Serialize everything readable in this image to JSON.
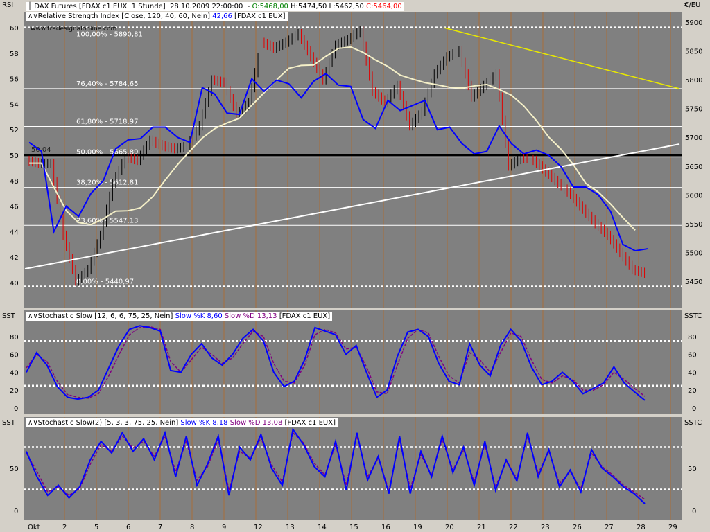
{
  "panels": [
    {
      "id": "rsi",
      "left_label": "RSI",
      "right_label": "€/EU",
      "header_lines": [
        [
          {
            "text": "DAX Futures [FDAX c1 EUX  1 Stunde]  28.10.2009 22:00:00  - ",
            "color": "#000000"
          },
          {
            "text": "O:5468,00",
            "color": "#008000"
          },
          {
            "text": " H:5474,50 L:5462,50 ",
            "color": "#000000"
          },
          {
            "text": "C:5464,00",
            "color": "#ff0000"
          }
        ],
        [
          {
            "text": "Relative Strength Index [Close, 120, 40, 60, Nein] ",
            "color": "#000000"
          },
          {
            "text": "42,66",
            "color": "#0000ff"
          },
          {
            "text": " [FDAX c1 EUX]",
            "color": "#000000"
          }
        ]
      ],
      "watermark": "www.tradesignalonline.com",
      "left_axis": {
        "ticks": [
          60,
          58,
          56,
          54,
          52,
          50,
          48,
          46,
          44,
          42,
          40
        ]
      },
      "right_axis": {
        "ticks": [
          "5900",
          "5850",
          "5800",
          "5750",
          "5700",
          "5650",
          "5600",
          "5550",
          "5500",
          "5450"
        ]
      },
      "fib_levels": [
        {
          "label": "100,00% - 5890,81",
          "price": 5890.81,
          "dotted": true
        },
        {
          "label": "76,40% - 5784,65",
          "price": 5784.65,
          "dotted": false
        },
        {
          "label": "61,80% - 5718,97",
          "price": 5718.97,
          "dotted": false
        },
        {
          "label": "50,00% - 5665,89",
          "price": 5665.89,
          "dotted": false
        },
        {
          "label": "38,20% - 5612,81",
          "price": 5612.81,
          "dotted": false
        },
        {
          "label": "23,60% - 5547,13",
          "price": 5547.13,
          "dotted": false
        },
        {
          "label": "0,00% - 5440,97",
          "price": 5440.97,
          "dotted": true
        }
      ],
      "rsi_midline": 50,
      "rsi_value_label": "50,04",
      "colors": {
        "rsi": "#0000ff",
        "ma": "#f5f0c8",
        "trend": "#ffffff",
        "resistance": "#e8e800",
        "up": "#000000",
        "down": "#e00000"
      }
    },
    {
      "id": "stoch1",
      "left_label": "SST",
      "right_label": "SSTC",
      "header_lines": [
        [
          {
            "text": "Stochastic Slow [12, 6, 6, 75, 25, Nein] ",
            "color": "#000000"
          },
          {
            "text": "Slow %K 8,60",
            "color": "#0000ff"
          },
          {
            "text": " ",
            "color": "#000000"
          },
          {
            "text": "Slow %D 13,13",
            "color": "#800080"
          },
          {
            "text": " [FDAX c1 EUX]",
            "color": "#000000"
          }
        ]
      ],
      "left_axis": {
        "ticks": [
          80,
          60,
          40,
          20,
          0
        ]
      },
      "right_axis": {
        "ticks": [
          "80",
          "60",
          "40",
          "20",
          "0"
        ]
      },
      "levels": [
        75,
        25
      ],
      "colors": {
        "k": "#0000ff",
        "d": "#800080"
      }
    },
    {
      "id": "stoch2",
      "left_label": "SST",
      "right_label": "SSTC",
      "header_lines": [
        [
          {
            "text": "Stochastic Slow(2) [5, 3, 3, 75, 25, Nein] ",
            "color": "#000000"
          },
          {
            "text": "Slow %K 8,18",
            "color": "#0000ff"
          },
          {
            "text": " ",
            "color": "#000000"
          },
          {
            "text": "Slow %D 13,08",
            "color": "#800080"
          },
          {
            "text": " [FDAX c1 EUX]",
            "color": "#000000"
          }
        ]
      ],
      "left_axis": {
        "ticks": [
          50,
          0
        ]
      },
      "right_axis": {
        "ticks": [
          "50",
          "0"
        ]
      },
      "levels": [
        75,
        25
      ],
      "colors": {
        "k": "#0000ff",
        "d": "#800080"
      }
    }
  ],
  "x_axis": {
    "labels": [
      "Okt",
      "2",
      "5",
      "6",
      "7",
      "8",
      "9",
      "12",
      "13",
      "14",
      "15",
      "16",
      "19",
      "20",
      "21",
      "22",
      "23",
      "26",
      "27",
      "28",
      "29"
    ]
  },
  "chart_data": [
    {
      "type": "line",
      "title": "DAX Futures [FDAX c1 EUX  1 Stunde]",
      "series": [
        {
          "name": "Relative Strength Index",
          "values": [
            51,
            50.3,
            44,
            46,
            45.2,
            47,
            48,
            50.5,
            51.2,
            51.3,
            52.2,
            52.2,
            51.4,
            51,
            55.3,
            54.8,
            53.3,
            53.2,
            56,
            55,
            55.9,
            55.6,
            54.5,
            55.8,
            56.4,
            55.5,
            55.4,
            52.8,
            52.1,
            54.3,
            53.5,
            53.9,
            54.3,
            52,
            52.2,
            50.9,
            50.1,
            50.3,
            52.3,
            50.9,
            50.1,
            50.4,
            50,
            49.1,
            47.5,
            47.5,
            46.9,
            45.6,
            43,
            42.5,
            42.66
          ]
        },
        {
          "name": "C",
          "values": [
            5655,
            5655,
            5530,
            5450,
            5470,
            5530,
            5620,
            5665,
            5660,
            5695,
            5685,
            5680,
            5685,
            5720,
            5800,
            5795,
            5740,
            5760,
            5865,
            5855,
            5865,
            5880,
            5840,
            5800,
            5860,
            5870,
            5885,
            5780,
            5760,
            5790,
            5720,
            5745,
            5810,
            5840,
            5850,
            5770,
            5790,
            5810,
            5650,
            5665,
            5660,
            5640,
            5620,
            5600,
            5575,
            5550,
            5530,
            5500,
            5470,
            5464
          ]
        }
      ]
    },
    {
      "type": "line",
      "title": "Stochastic Slow [12, 6, 6, 75, 25, Nein]",
      "ylim": [
        0,
        100
      ],
      "series": [
        {
          "name": "Slow %K",
          "values": [
            40,
            62,
            48,
            24,
            12,
            10,
            12,
            20,
            45,
            70,
            88,
            92,
            90,
            86,
            42,
            40,
            60,
            72,
            56,
            48,
            60,
            78,
            88,
            75,
            40,
            24,
            30,
            54,
            90,
            86,
            82,
            60,
            70,
            40,
            12,
            20,
            58,
            85,
            88,
            80,
            50,
            30,
            26,
            72,
            48,
            36,
            70,
            88,
            75,
            46,
            26,
            30,
            40,
            30,
            16,
            22,
            28,
            46,
            28,
            18,
            8.6
          ]
        },
        {
          "name": "Slow %D",
          "values": [
            45,
            60,
            52,
            30,
            15,
            12,
            11,
            16,
            36,
            60,
            82,
            90,
            91,
            88,
            52,
            40,
            54,
            68,
            60,
            50,
            56,
            72,
            86,
            80,
            50,
            30,
            28,
            48,
            82,
            88,
            84,
            66,
            68,
            46,
            18,
            16,
            48,
            78,
            88,
            84,
            58,
            36,
            28,
            62,
            54,
            40,
            62,
            84,
            80,
            54,
            32,
            28,
            36,
            32,
            20,
            20,
            26,
            40,
            32,
            22,
            13.13
          ]
        }
      ]
    },
    {
      "type": "line",
      "title": "Stochastic Slow(2) [5, 3, 3, 75, 25, Nein]",
      "series": [
        {
          "name": "Slow %K",
          "values": [
            70,
            40,
            18,
            30,
            15,
            28,
            60,
            82,
            68,
            92,
            70,
            85,
            60,
            92,
            40,
            88,
            30,
            55,
            88,
            18,
            75,
            60,
            90,
            50,
            30,
            96,
            78,
            52,
            40,
            82,
            24,
            92,
            36,
            64,
            20,
            88,
            20,
            70,
            40,
            88,
            45,
            75,
            30,
            82,
            24,
            60,
            35,
            92,
            40,
            72,
            28,
            48,
            22,
            72,
            50,
            40,
            28,
            20,
            8.18
          ]
        },
        {
          "name": "Slow %D",
          "values": [
            68,
            46,
            22,
            28,
            18,
            26,
            55,
            78,
            70,
            88,
            74,
            82,
            64,
            88,
            46,
            82,
            36,
            52,
            84,
            24,
            70,
            62,
            86,
            54,
            34,
            92,
            80,
            56,
            42,
            78,
            30,
            88,
            40,
            62,
            24,
            84,
            26,
            66,
            42,
            84,
            48,
            72,
            34,
            78,
            28,
            58,
            38,
            88,
            44,
            70,
            32,
            46,
            26,
            68,
            52,
            42,
            30,
            22,
            13.08
          ]
        }
      ]
    }
  ]
}
